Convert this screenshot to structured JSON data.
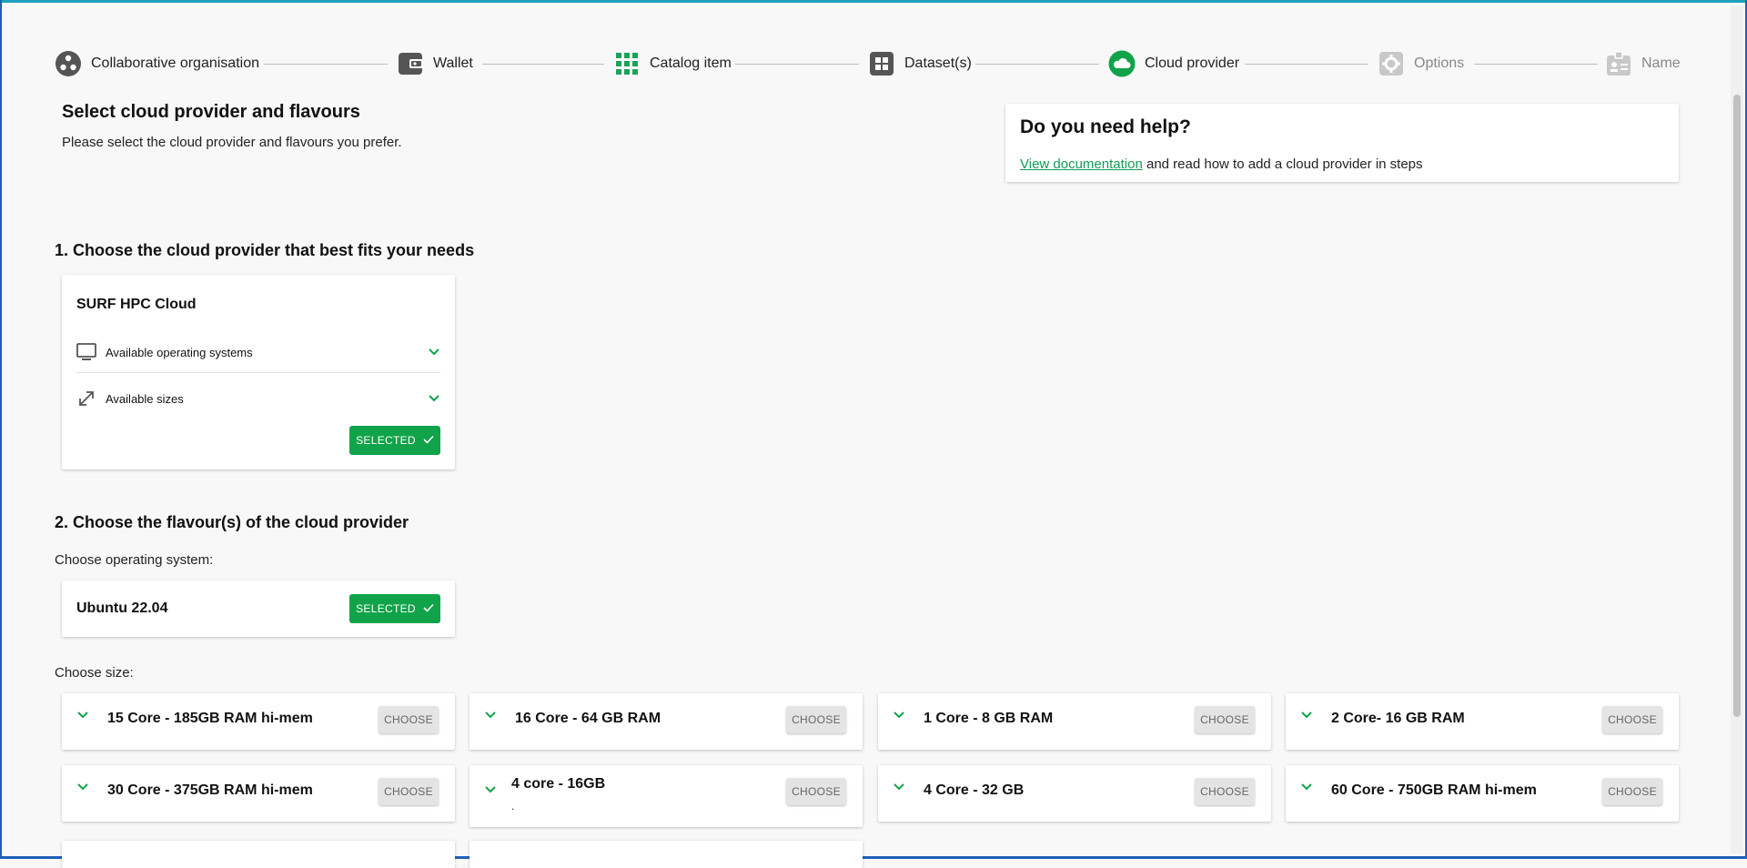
{
  "stepper": {
    "steps": [
      {
        "label": "Collaborative organisation",
        "icon": "organisation-icon",
        "state": "done"
      },
      {
        "label": "Wallet",
        "icon": "wallet-icon",
        "state": "done"
      },
      {
        "label": "Catalog item",
        "icon": "grid-icon",
        "state": "done"
      },
      {
        "label": "Dataset(s)",
        "icon": "dataset-icon",
        "state": "done"
      },
      {
        "label": "Cloud provider",
        "icon": "cloud-icon",
        "state": "active"
      },
      {
        "label": "Options",
        "icon": "gear-icon",
        "state": "inactive"
      },
      {
        "label": "Name",
        "icon": "badge-icon",
        "state": "inactive"
      }
    ]
  },
  "header": {
    "title": "Select cloud provider and flavours",
    "subtitle": "Please select the cloud provider and flavours you prefer."
  },
  "help": {
    "title": "Do you need help?",
    "link_text": "View documentation",
    "text": " and read how to add a cloud provider in steps"
  },
  "section1": {
    "title": "1. Choose the cloud provider that best fits your needs",
    "provider": {
      "name": "SURF HPC Cloud",
      "os_label": "Available operating systems",
      "sizes_label": "Available sizes",
      "button": "SELECTED"
    }
  },
  "section2": {
    "title": "2. Choose the flavour(s) of the cloud provider",
    "os_label": "Choose operating system:",
    "os": {
      "name": "Ubuntu 22.04",
      "button": "SELECTED"
    },
    "size_label": "Choose size:",
    "choose_label": "CHOOSE",
    "sizes": [
      {
        "label": "15 Core - 185GB RAM hi-mem"
      },
      {
        "label": "16 Core - 64 GB RAM"
      },
      {
        "label": "1 Core - 8 GB RAM"
      },
      {
        "label": "2 Core- 16 GB RAM"
      },
      {
        "label": "30 Core - 375GB RAM hi-mem"
      },
      {
        "label": "4 core - 16GB",
        "sub": "."
      },
      {
        "label": "4 Core - 32 GB"
      },
      {
        "label": "60 Core - 750GB RAM hi-mem"
      }
    ]
  },
  "colors": {
    "accent": "#10a34a",
    "link": "#169b54",
    "inactive": "#bdbdbd"
  }
}
